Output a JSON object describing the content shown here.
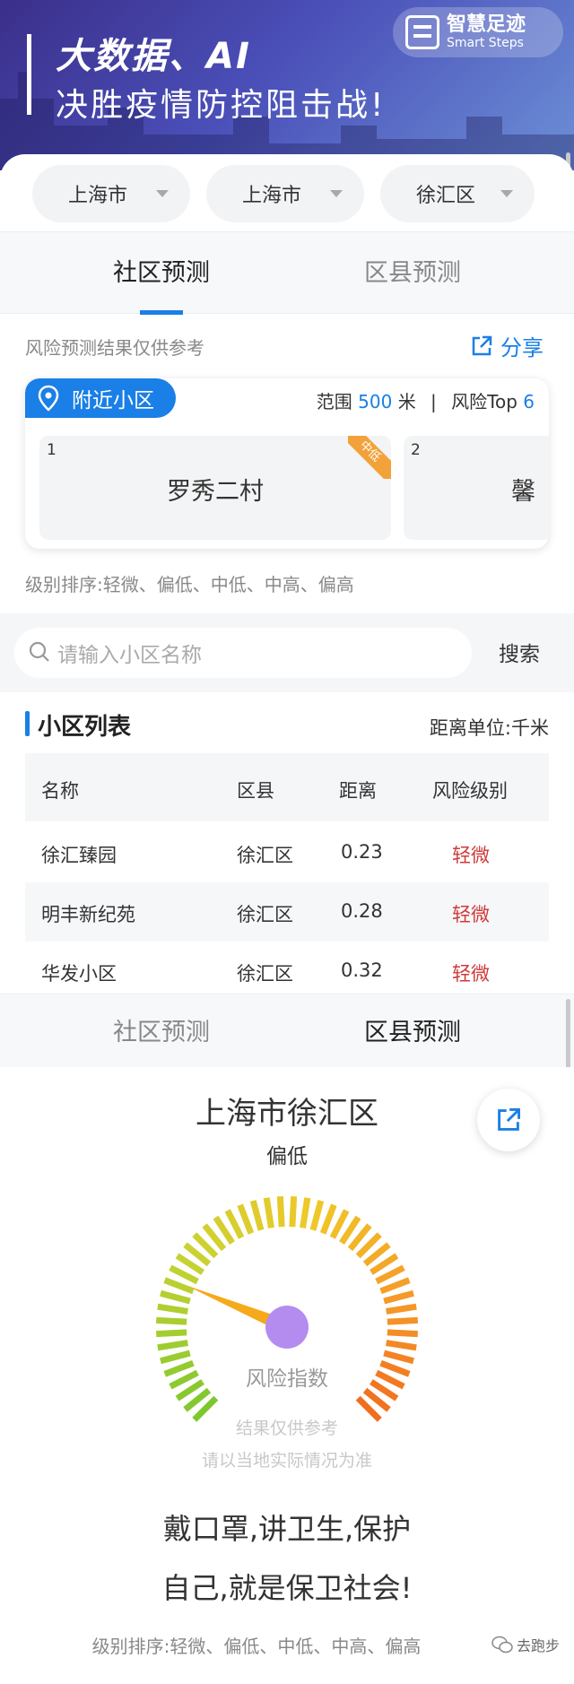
{
  "banner": {
    "title_line1": "大数据、AI",
    "title_line2": "决胜疫情防控阻击战!",
    "logo_cn": "智慧足迹",
    "logo_en": "Smart Steps"
  },
  "selectors": [
    {
      "value": "上海市"
    },
    {
      "value": "上海市"
    },
    {
      "value": "徐汇区"
    }
  ],
  "tabs_top": [
    {
      "label": "社区预测",
      "active": true
    },
    {
      "label": "区县预测",
      "active": false
    }
  ],
  "disclaimer": "风险预测结果仅供参考",
  "share_label": "分享",
  "nearby": {
    "pill_label": "附近小区",
    "range_prefix": "范围",
    "range_value": "500",
    "range_unit": "米",
    "divider": "|",
    "top_prefix": "风险Top",
    "top_value": "6",
    "items": [
      {
        "index": "1",
        "name": "罗秀二村",
        "tag": "中低"
      },
      {
        "index": "2",
        "name": "馨"
      }
    ]
  },
  "level_order": "级别排序:轻微、偏低、中低、中高、偏高",
  "search": {
    "placeholder": "请输入小区名称",
    "button": "搜索"
  },
  "list": {
    "title": "小区列表",
    "unit": "距离单位:千米",
    "headers": [
      "名称",
      "区县",
      "距离",
      "风险级别"
    ],
    "rows": [
      [
        "徐汇臻园",
        "徐汇区",
        "0.23",
        "轻微"
      ],
      [
        "明丰新纪苑",
        "徐汇区",
        "0.28",
        "轻微"
      ],
      [
        "华发小区",
        "徐汇区",
        "0.32",
        "轻微"
      ]
    ]
  },
  "tabs_bottom": [
    {
      "label": "社区预测",
      "active": false
    },
    {
      "label": "区县预测",
      "active": true
    }
  ],
  "district": {
    "name": "上海市徐汇区",
    "level": "偏低",
    "index_label": "风险指数",
    "note1": "结果仅供参考",
    "note2": "请以当地实际情况为准",
    "gauge_level": 0.25
  },
  "slogan": {
    "line1": "戴口罩,讲卫生,保护",
    "line2": "自己,就是保卫社会!"
  },
  "level_order_bottom": "级别排序:轻微、偏低、中低、中高、偏高",
  "watermark": "去跑步",
  "colors": {
    "accent": "#1a7fe6",
    "risk": "#d03a3a",
    "tag": "#f2a23a",
    "needle": "#f6a91b",
    "pivot": "#b48cf0"
  }
}
